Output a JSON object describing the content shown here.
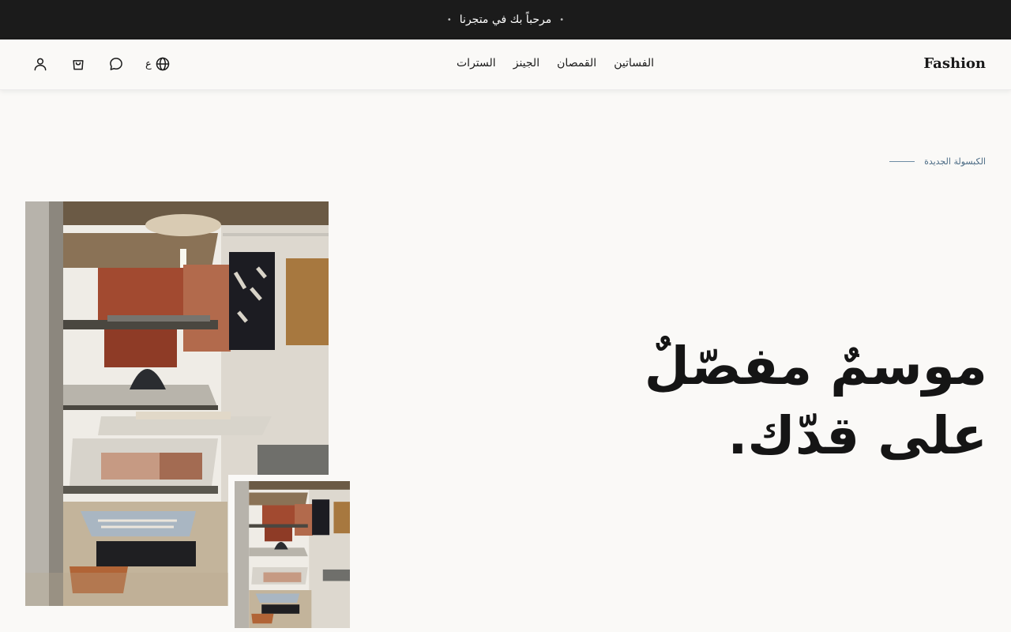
{
  "announcement": {
    "text": "مرحباً بك في متجرنا",
    "dot": "•"
  },
  "header": {
    "logo": "Fashion",
    "nav": [
      {
        "label": "الفساتين"
      },
      {
        "label": "القمصان"
      },
      {
        "label": "الجينز"
      },
      {
        "label": "السترات"
      }
    ],
    "lang_label": "ع",
    "icons": [
      "globe-icon",
      "chat-icon",
      "cart-icon",
      "user-icon"
    ]
  },
  "hero": {
    "eyebrow": "الكبسولة الجديدة",
    "title_line1": "موسمٌ مفصّلٌ",
    "title_line2": "على قدّك."
  },
  "colors": {
    "announce_bg": "#1b1b1b",
    "page_bg": "#faf9f7",
    "accent": "#4a6a84",
    "text": "#1a1a1a"
  }
}
